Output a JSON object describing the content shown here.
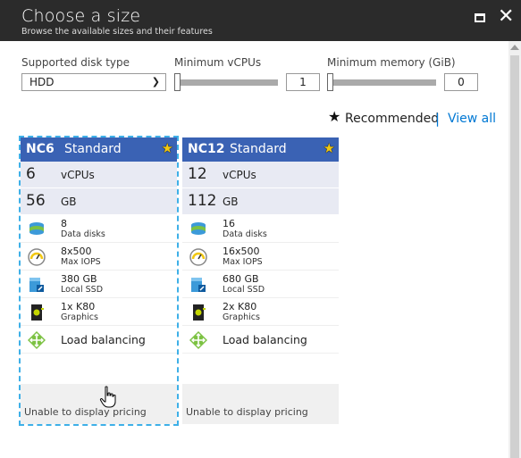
{
  "header": {
    "title": "Choose a size",
    "subtitle": "Browse the available sizes and their features"
  },
  "filters": {
    "disk_type_label": "Supported disk type",
    "disk_type_value": "HDD",
    "min_vcpu_label": "Minimum vCPUs",
    "min_vcpu_value": "1",
    "min_memory_label": "Minimum memory (GiB)",
    "min_memory_value": "0"
  },
  "legend": {
    "recommended": "Recommended",
    "separator": "|",
    "view_all": "View all"
  },
  "cards": [
    {
      "name": "NC6",
      "tier": "Standard",
      "vcpus": "6",
      "vcpus_label": "vCPUs",
      "memory": "56",
      "memory_label": "GB",
      "disks": "8",
      "disks_label": "Data disks",
      "iops": "8x500",
      "iops_label": "Max IOPS",
      "ssd": "380 GB",
      "ssd_label": "Local SSD",
      "gpu": "1x K80",
      "gpu_label": "Graphics",
      "lb": "Load balancing",
      "pricing": "Unable to display pricing"
    },
    {
      "name": "NC12",
      "tier": "Standard",
      "vcpus": "12",
      "vcpus_label": "vCPUs",
      "memory": "112",
      "memory_label": "GB",
      "disks": "16",
      "disks_label": "Data disks",
      "iops": "16x500",
      "iops_label": "Max IOPS",
      "ssd": "680 GB",
      "ssd_label": "Local SSD",
      "gpu": "2x K80",
      "gpu_label": "Graphics",
      "lb": "Load balancing",
      "pricing": "Unable to display pricing"
    }
  ],
  "colors": {
    "header_bg": "#2b2b2b",
    "card_header": "#3a62b4",
    "accent_link": "#0078d4",
    "selection_outline": "#3eb0e8"
  },
  "icons": [
    "maximize-icon",
    "close-icon",
    "chevron-down-icon",
    "star-icon",
    "data-disks-icon",
    "iops-gauge-icon",
    "local-ssd-icon",
    "graphics-card-icon",
    "load-balancing-icon",
    "hand-cursor-icon"
  ]
}
